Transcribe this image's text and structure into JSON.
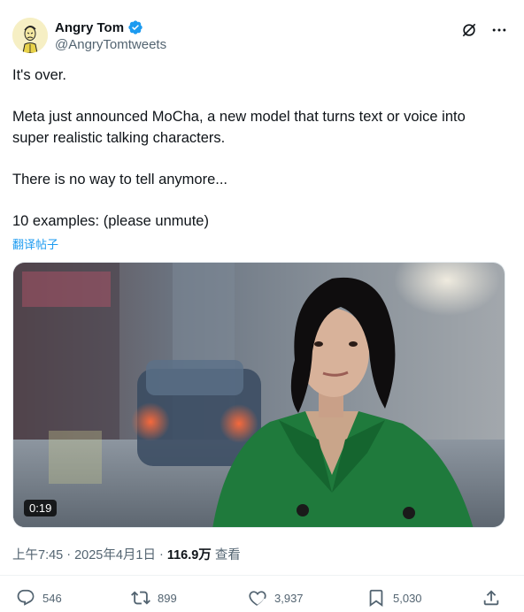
{
  "author": {
    "display_name": "Angry Tom",
    "handle": "@AngryTomtweets",
    "avatar_icon": "cartoon-man-avatar",
    "verified_color": "#1d9bf0"
  },
  "tweet": {
    "lines": [
      "It's over.",
      "Meta just announced MoCha, a new model that turns text or voice into",
      "super realistic talking characters.",
      "There is no way to tell anymore...",
      "10 examples: (please unmute)"
    ],
    "translate_label": "翻译帖子"
  },
  "media": {
    "duration": "0:19"
  },
  "meta": {
    "time": "上午7:45",
    "separator1": "·",
    "date": "2025年4月1日",
    "separator2": "·",
    "views": "116.9万",
    "views_label": "查看"
  },
  "actions": {
    "replies": "546",
    "reposts": "899",
    "likes": "3,937",
    "bookmarks": "5,030"
  },
  "colors": {
    "accent": "#1d9bf0",
    "text": "#0f1419",
    "muted": "#536471"
  }
}
